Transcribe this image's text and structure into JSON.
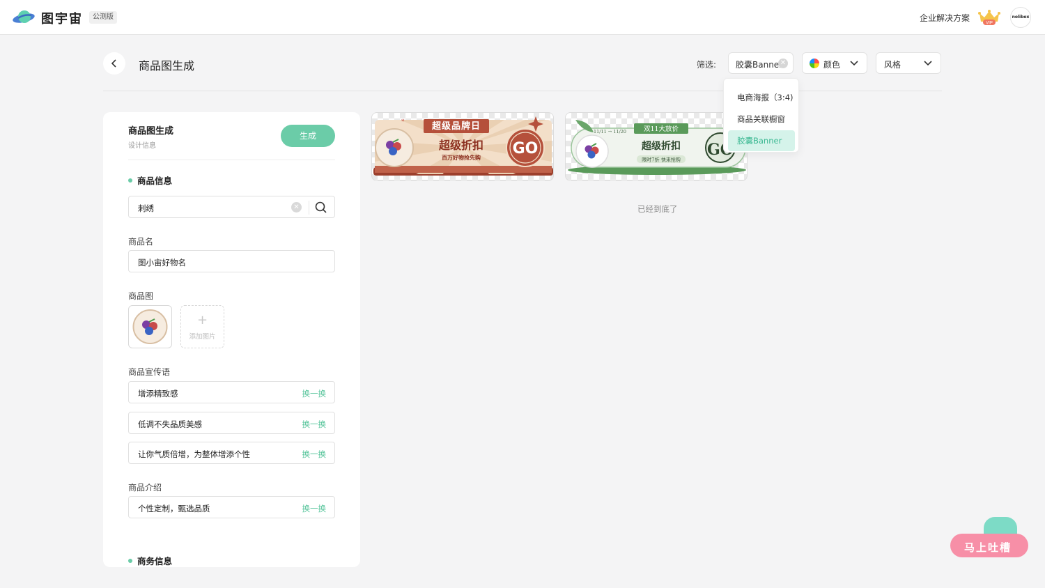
{
  "topbar": {
    "brand": "图宇宙",
    "badge": "公测版",
    "enterprise": "企业解决方案",
    "vip_label": "VIP",
    "avatar_text": "nolibox"
  },
  "header": {
    "title": "商品图生成",
    "filter_label": "筛选:",
    "filter_capsule": "胶囊Banner",
    "filter_color": "颜色",
    "filter_style": "风格"
  },
  "dropdown": {
    "items": [
      {
        "label": "电商海报（3:4)"
      },
      {
        "label": "商品关联橱窗"
      },
      {
        "label": "胶囊Banner",
        "active": true
      }
    ]
  },
  "panel": {
    "title": "商品图生成",
    "subtitle": "设计信息",
    "generate": "生成",
    "product_section": "商品信息",
    "search_value": "刺绣",
    "name_label": "商品名",
    "name_value": "图小宙好物名",
    "image_label": "商品图",
    "add_image": "添加图片",
    "slogan_label": "商品宣传语",
    "slogans": [
      "增添精致感",
      "低调不失品质美感",
      "让你气质倍增，为整体增添个性"
    ],
    "swap": "换一换",
    "intro_label": "商品介绍",
    "intro_value": "个性定制，甄选品质",
    "business_section": "商务信息"
  },
  "cards": {
    "card1": {
      "ribbon": "超级品牌日",
      "headline": "超级折扣",
      "sub": "百万好物抢先购",
      "go": "GO"
    },
    "card2": {
      "dates": "11/11 → 11/20",
      "ribbon": "双11大放价",
      "headline": "超级折扣",
      "sub": "限时7折 快来抢购",
      "go": "GO"
    }
  },
  "end_text": "已经到底了",
  "feedback": {
    "label": "马上吐槽"
  },
  "colors": {
    "accent": "#6bcca8",
    "active_bg": "#d5f3ea",
    "feedback_pink": "#f78fa7",
    "card1_brown": "#b5503b",
    "card2_green": "#5a9a5a"
  }
}
